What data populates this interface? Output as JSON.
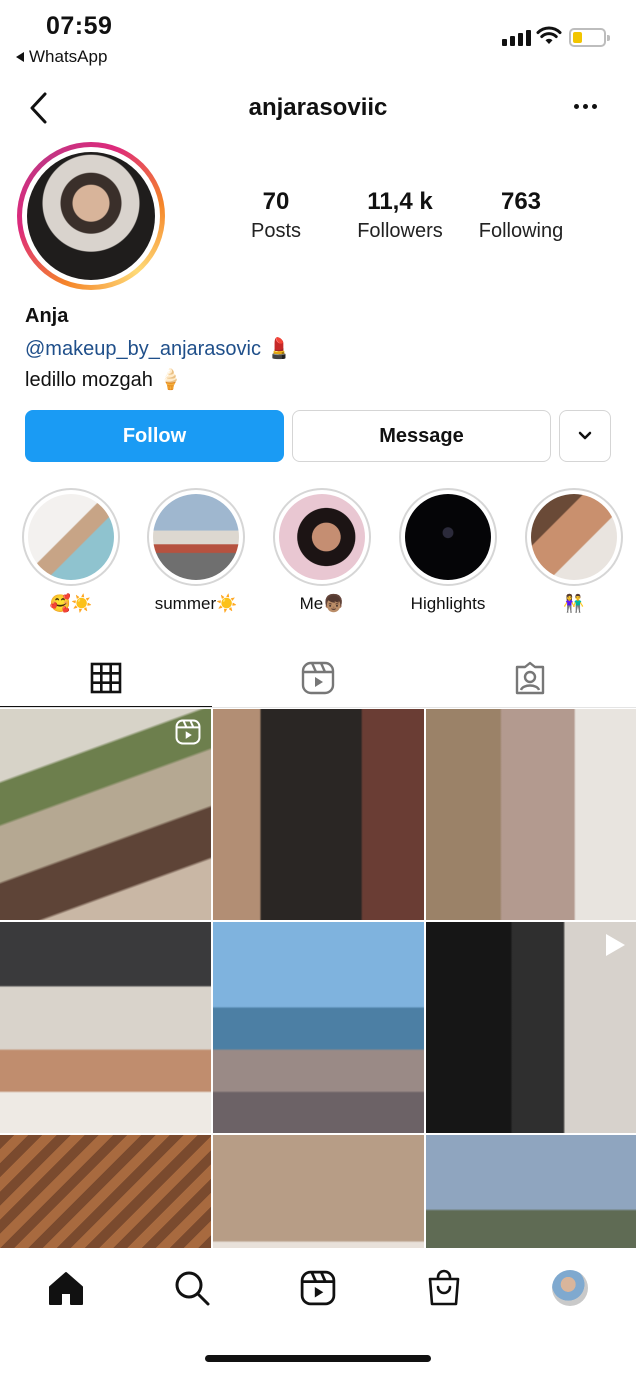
{
  "status_bar": {
    "time": "07:59",
    "back_app": "WhatsApp"
  },
  "header": {
    "username": "anjarasoviic"
  },
  "profile": {
    "stats": [
      {
        "value": "70",
        "label": "Posts"
      },
      {
        "value": "11,4 k",
        "label": "Followers"
      },
      {
        "value": "763",
        "label": "Following"
      }
    ],
    "name": "Anja",
    "link": "@makeup_by_anjarasovic 💄",
    "bio": "ledillo mozgah 🍦"
  },
  "actions": {
    "follow": "Follow",
    "message": "Message"
  },
  "highlights": [
    {
      "label": "🥰☀️"
    },
    {
      "label": "summer☀️"
    },
    {
      "label": "Me👦🏽"
    },
    {
      "label": "Highlights"
    },
    {
      "label": "👫"
    }
  ],
  "tabs": [
    {
      "icon": "grid-icon"
    },
    {
      "icon": "reels-icon"
    },
    {
      "icon": "tagged-icon"
    }
  ],
  "posts": [
    {
      "badge": "reel"
    },
    {
      "badge": ""
    },
    {
      "badge": ""
    },
    {
      "badge": ""
    },
    {
      "badge": ""
    },
    {
      "badge": "video"
    },
    {
      "badge": ""
    },
    {
      "badge": ""
    },
    {
      "badge": ""
    }
  ],
  "bottom_nav": [
    "home-icon",
    "search-icon",
    "reels-icon",
    "shop-icon",
    "profile-avatar"
  ],
  "colors": {
    "follow_blue": "#1a9bf4",
    "link_blue": "#1f4f8a",
    "battery_yellow": "#f2c500"
  }
}
